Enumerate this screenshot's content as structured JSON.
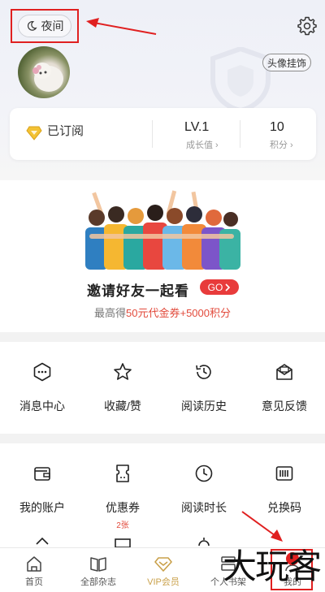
{
  "header": {
    "night_mode_label": "夜间",
    "avatar_pendant_label": "头像挂饰"
  },
  "stats_card": {
    "subscribed_label": "已订阅",
    "level_value": "LV.1",
    "level_caption": "成长值",
    "points_value": "10",
    "points_caption": "积分"
  },
  "invite": {
    "title": "邀请好友一起看",
    "go_label": "GO",
    "subtitle_prefix": "最高得",
    "subtitle_highlight": "50元代金券+5000积分"
  },
  "grid_row1": [
    {
      "label": "消息中心",
      "icon": "message-icon"
    },
    {
      "label": "收藏/赞",
      "icon": "star-icon"
    },
    {
      "label": "阅读历史",
      "icon": "history-icon"
    },
    {
      "label": "意见反馈",
      "icon": "feedback-icon"
    }
  ],
  "grid_row2": [
    {
      "label": "我的账户",
      "icon": "wallet-icon"
    },
    {
      "label": "优惠券",
      "icon": "coupon-icon",
      "badge": "2张"
    },
    {
      "label": "阅读时长",
      "icon": "clock-icon"
    },
    {
      "label": "兑换码",
      "icon": "barcode-icon"
    }
  ],
  "bottom_nav": [
    {
      "label": "首页",
      "icon": "home-icon"
    },
    {
      "label": "全部杂志",
      "icon": "book-icon"
    },
    {
      "label": "VIP会员",
      "icon": "vip-diamond-icon",
      "active": true
    },
    {
      "label": "个人书架",
      "icon": "bookshelf-icon"
    },
    {
      "label": "我的",
      "icon": "profile-icon"
    }
  ],
  "watermark_text": "大玩客",
  "colors": {
    "accent_red": "#e83b3b",
    "vip_gold": "#c9a04a",
    "annotation_red": "#e02020"
  }
}
